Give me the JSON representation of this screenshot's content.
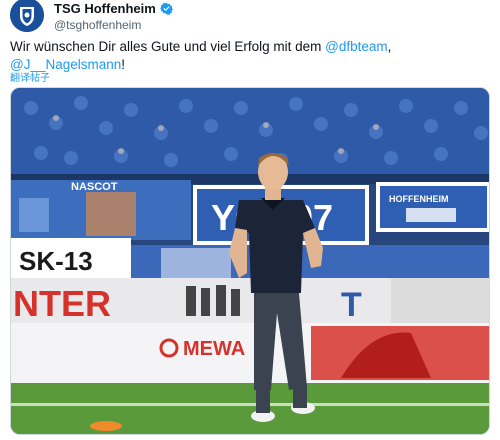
{
  "account": {
    "display_name": "TSG Hoffenheim",
    "handle": "@tsghoffenheim",
    "avatar_icon": "club-crest-icon",
    "verified_icon": "verified-badge-icon"
  },
  "tweet": {
    "text_part1": "Wir wünschen Dir alles Gute und viel Erfolg mit dem ",
    "mention1": "@dfbteam",
    "text_part2": ",",
    "mention2": "@J__Nagelsmann",
    "text_part3": "!",
    "translate_label": "翻译帖子"
  },
  "photo": {
    "banner_left_text": "NASCOT",
    "banner_mid_text": "YO 107",
    "banner_right_text": "HOFFENHEIM",
    "sign_sk": "SK-13",
    "ad_left_text": "NTER",
    "ad_mewa_text": "MEWA",
    "ad_right_text": "T",
    "colors": {
      "crowd_blue": "#2e5aa8",
      "pitch_green": "#5a9a3a",
      "ad_red": "#d6322b",
      "accent": "#1d9bf0"
    }
  }
}
